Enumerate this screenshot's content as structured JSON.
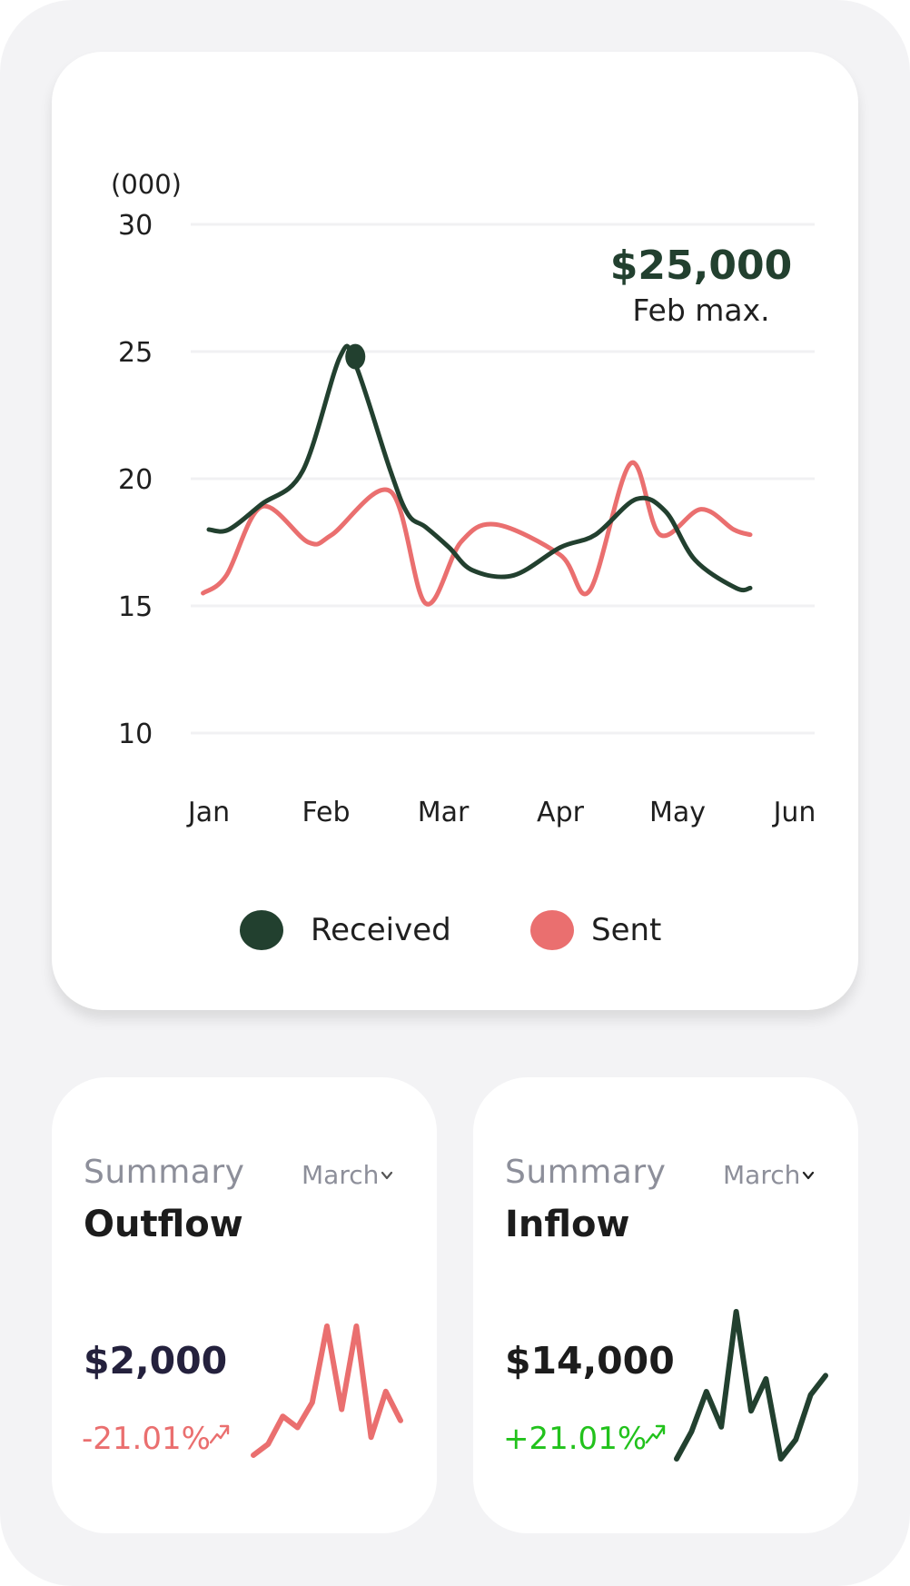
{
  "colors": {
    "received": "#22402f",
    "sent": "#ea6f6f",
    "negative": "#ea6f6f",
    "positive": "#22c21c",
    "muted": "#8d8f9a",
    "grid": "#f1f1f3"
  },
  "chart_data": {
    "type": "line",
    "unit_label": "(000)",
    "y_ticks": [
      30,
      25,
      20,
      15,
      10
    ],
    "categories": [
      "Jan",
      "Feb",
      "Mar",
      "Apr",
      "May",
      "Jun"
    ],
    "series": [
      {
        "name": "Received",
        "x": [
          0,
          0.17,
          0.45,
          0.8,
          1.12,
          1.25,
          1.55,
          1.7,
          1.85,
          2.05,
          2.25,
          2.6,
          3.0,
          3.3,
          3.65,
          3.9,
          4.15,
          4.5,
          4.62
        ],
        "values": [
          18.0,
          18.0,
          19.0,
          20.3,
          24.8,
          24.5,
          20.3,
          18.6,
          18.1,
          17.3,
          16.4,
          16.2,
          17.3,
          17.8,
          19.2,
          18.7,
          16.8,
          15.7,
          15.7
        ]
      },
      {
        "name": "Sent",
        "x": [
          -0.05,
          0.15,
          0.45,
          0.85,
          1.05,
          1.55,
          1.85,
          2.15,
          2.45,
          3.0,
          3.25,
          3.6,
          3.85,
          4.2,
          4.48,
          4.62
        ],
        "values": [
          15.5,
          16.2,
          18.9,
          17.5,
          17.8,
          19.5,
          15.1,
          17.5,
          18.2,
          17.0,
          15.6,
          20.6,
          17.8,
          18.8,
          18.0,
          17.8
        ]
      }
    ],
    "marker": {
      "series": "Received",
      "x": 1.25,
      "value": 24.8
    },
    "annotation": {
      "value": "$25,000",
      "label": "Feb max."
    },
    "ylim": [
      10,
      30
    ],
    "grid": true,
    "legend": [
      "Received",
      "Sent"
    ],
    "legend_position": "bottom"
  },
  "outflow": {
    "summary_label": "Summary",
    "month": "March",
    "title": "Outflow",
    "amount": "$2,000",
    "change": "-21.01%",
    "sparkline": [
      2,
      10,
      30,
      22,
      40,
      95,
      35,
      95,
      15,
      48,
      27
    ]
  },
  "inflow": {
    "summary_label": "Summary",
    "month": "March",
    "title": "Inflow",
    "amount": "$14,000",
    "change": "+21.01%",
    "sparkline": [
      8,
      25,
      50,
      28,
      100,
      38,
      58,
      8,
      20,
      48,
      60
    ]
  }
}
